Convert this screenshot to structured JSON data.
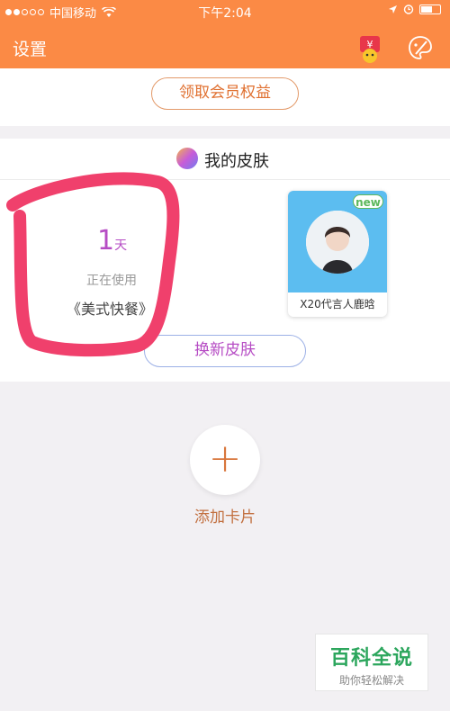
{
  "status_bar": {
    "carrier": "中国移动",
    "time": "下午2:04"
  },
  "nav": {
    "title": "设置",
    "icons": [
      "vip-icon",
      "palette-icon"
    ]
  },
  "member": {
    "button_label": "领取会员权益"
  },
  "skin": {
    "section_title": "我的皮肤",
    "days_number": "1",
    "days_unit": "天",
    "status_text": "正在使用",
    "current_skin": "《美式快餐》",
    "preview_badge": "new",
    "preview_caption": "X20代言人鹿晗",
    "change_button": "换新皮肤"
  },
  "add_card": {
    "icon": "+",
    "label": "添加卡片"
  },
  "watermark": {
    "title": "百科全说",
    "subtitle": "助你轻松解决"
  },
  "colors": {
    "nav_bg": "#fb8a45",
    "accent_purple": "#b64cc4",
    "annotation_red": "#f0406c"
  }
}
